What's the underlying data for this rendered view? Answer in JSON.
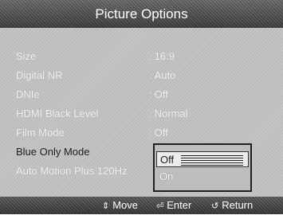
{
  "title": "Picture Options",
  "menu": {
    "items": [
      {
        "label": "Size",
        "value": "16:9"
      },
      {
        "label": "Digital NR",
        "value": "Auto"
      },
      {
        "label": "DNIe",
        "value": "Off"
      },
      {
        "label": "HDMI Black Level",
        "value": "Normal"
      },
      {
        "label": "Film Mode",
        "value": "Off"
      },
      {
        "label": "Blue Only Mode",
        "value": ""
      },
      {
        "label": "Auto Motion Plus 120Hz",
        "value": ""
      }
    ]
  },
  "dropdown": {
    "options": [
      "Off",
      "On"
    ],
    "selected": "Off"
  },
  "hints": {
    "move_label": "Move",
    "move_icon": "updown-arrow-icon",
    "enter_label": "Enter",
    "enter_icon": "enter-icon",
    "return_label": "Return",
    "return_icon": "return-icon"
  }
}
